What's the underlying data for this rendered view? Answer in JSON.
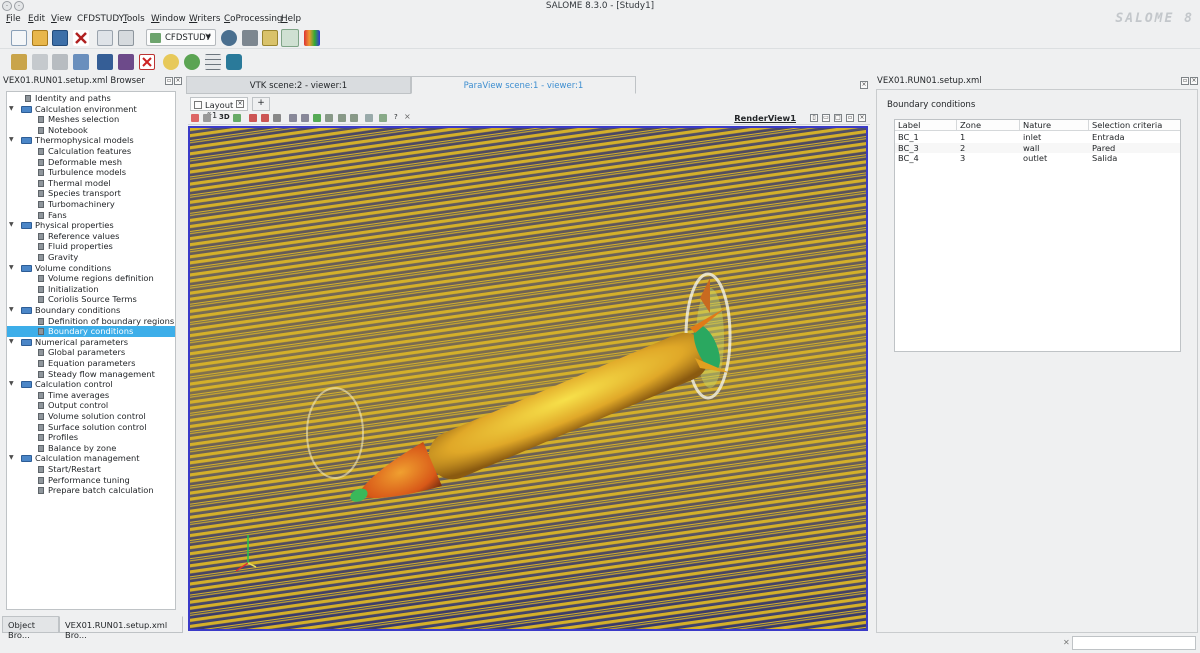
{
  "window": {
    "title": "SALOME 8.3.0 - [Study1]",
    "logo": "SALOME 8"
  },
  "menubar": [
    {
      "label": "File",
      "u": "F",
      "rest": "ile"
    },
    {
      "label": "Edit",
      "u": "E",
      "rest": "dit"
    },
    {
      "label": "View",
      "u": "V",
      "rest": "iew"
    },
    {
      "label": "CFDSTUDY",
      "u": "",
      "rest": "CFDSTUDY"
    },
    {
      "label": "Tools",
      "u": "T",
      "rest": "ools"
    },
    {
      "label": "Window",
      "u": "W",
      "rest": "indow"
    },
    {
      "label": "Writers",
      "u": "W",
      "rest": "riters"
    },
    {
      "label": "CoProcessing",
      "u": "C",
      "rest": "oProcessing"
    },
    {
      "label": "Help",
      "u": "H",
      "rest": "elp"
    }
  ],
  "toolbar": {
    "module_combo": "CFDSTUDY"
  },
  "left_panel": {
    "title": "VEX01.RUN01.setup.xml Browser",
    "tree": [
      {
        "label": "Identity and paths",
        "level": 1,
        "type": "doc"
      },
      {
        "label": "Calculation environment",
        "level": 0,
        "type": "folder"
      },
      {
        "label": "Meshes selection",
        "level": 1,
        "type": "doc"
      },
      {
        "label": "Notebook",
        "level": 1,
        "type": "doc"
      },
      {
        "label": "Thermophysical models",
        "level": 0,
        "type": "folder"
      },
      {
        "label": "Calculation features",
        "level": 1,
        "type": "doc"
      },
      {
        "label": "Deformable mesh",
        "level": 1,
        "type": "doc"
      },
      {
        "label": "Turbulence models",
        "level": 1,
        "type": "doc"
      },
      {
        "label": "Thermal model",
        "level": 1,
        "type": "doc"
      },
      {
        "label": "Species transport",
        "level": 1,
        "type": "doc"
      },
      {
        "label": "Turbomachinery",
        "level": 1,
        "type": "doc"
      },
      {
        "label": "Fans",
        "level": 1,
        "type": "doc"
      },
      {
        "label": "Physical properties",
        "level": 0,
        "type": "folder"
      },
      {
        "label": "Reference values",
        "level": 1,
        "type": "doc"
      },
      {
        "label": "Fluid properties",
        "level": 1,
        "type": "doc"
      },
      {
        "label": "Gravity",
        "level": 1,
        "type": "doc"
      },
      {
        "label": "Volume conditions",
        "level": 0,
        "type": "folder"
      },
      {
        "label": "Volume regions definition",
        "level": 1,
        "type": "doc"
      },
      {
        "label": "Initialization",
        "level": 1,
        "type": "doc"
      },
      {
        "label": "Coriolis Source Terms",
        "level": 1,
        "type": "doc"
      },
      {
        "label": "Boundary conditions",
        "level": 0,
        "type": "folder"
      },
      {
        "label": "Definition of boundary regions",
        "level": 1,
        "type": "doc"
      },
      {
        "label": "Boundary conditions",
        "level": 1,
        "type": "doc",
        "selected": true
      },
      {
        "label": "Numerical parameters",
        "level": 0,
        "type": "folder"
      },
      {
        "label": "Global parameters",
        "level": 1,
        "type": "doc"
      },
      {
        "label": "Equation parameters",
        "level": 1,
        "type": "doc"
      },
      {
        "label": "Steady flow management",
        "level": 1,
        "type": "doc"
      },
      {
        "label": "Calculation control",
        "level": 0,
        "type": "folder"
      },
      {
        "label": "Time averages",
        "level": 1,
        "type": "doc"
      },
      {
        "label": "Output control",
        "level": 1,
        "type": "doc"
      },
      {
        "label": "Volume solution control",
        "level": 1,
        "type": "doc"
      },
      {
        "label": "Surface solution control",
        "level": 1,
        "type": "doc"
      },
      {
        "label": "Profiles",
        "level": 1,
        "type": "doc"
      },
      {
        "label": "Balance by zone",
        "level": 1,
        "type": "doc"
      },
      {
        "label": "Calculation management",
        "level": 0,
        "type": "folder"
      },
      {
        "label": "Start/Restart",
        "level": 1,
        "type": "doc"
      },
      {
        "label": "Performance tuning",
        "level": 1,
        "type": "doc"
      },
      {
        "label": "Prepare batch calculation",
        "level": 1,
        "type": "doc"
      }
    ],
    "bottom_tabs": [
      "Object Bro...",
      "VEX01.RUN01.setup.xml Bro..."
    ]
  },
  "viewer": {
    "tabs": [
      "VTK scene:2 - viewer:1",
      "ParaView scene:1 - viewer:1"
    ],
    "layout_tab": "Layout #1",
    "add_tab": "+",
    "toolbar_3d": "3D",
    "render_view": "RenderView1"
  },
  "right_panel": {
    "title": "VEX01.RUN01.setup.xml",
    "heading": "Boundary conditions",
    "columns": [
      "Label",
      "Zone",
      "Nature",
      "Selection criteria"
    ],
    "rows": [
      [
        "BC_1",
        "1",
        "inlet",
        "Entrada"
      ],
      [
        "BC_3",
        "2",
        "wall",
        "Pared"
      ],
      [
        "BC_4",
        "3",
        "outlet",
        "Salida"
      ]
    ]
  },
  "colors": {
    "selection": "#3daee9",
    "viewport_border": "#3a3ac8",
    "background": "#eff0f1"
  }
}
